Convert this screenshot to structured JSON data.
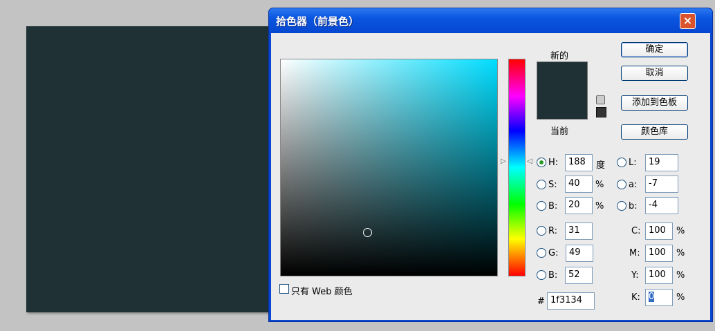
{
  "dialog": {
    "title": "拾色器（前景色）",
    "close_icon": "×"
  },
  "preview": {
    "new_label": "新的",
    "current_label": "当前",
    "new_color": "#1f3134",
    "current_color": "#1f3134"
  },
  "buttons": {
    "ok": "确定",
    "cancel": "取消",
    "add_swatch": "添加到色板",
    "libraries": "颜色库"
  },
  "hsb": {
    "h_label": "H:",
    "h": "188",
    "h_unit": "度",
    "s_label": "S:",
    "s": "40",
    "s_unit": "%",
    "b_label": "B:",
    "b": "20",
    "b_unit": "%"
  },
  "rgb": {
    "r_label": "R:",
    "r": "31",
    "g_label": "G:",
    "g": "49",
    "b_label": "B:",
    "b": "52"
  },
  "lab": {
    "l_label": "L:",
    "l": "19",
    "a_label": "a:",
    "a": "-7",
    "b_label": "b:",
    "b": "-4"
  },
  "cmyk": {
    "c_label": "C:",
    "c": "100",
    "m_label": "M:",
    "m": "100",
    "y_label": "Y:",
    "y": "100",
    "k_label": "K:",
    "k": "0",
    "unit": "%"
  },
  "hex": {
    "label": "#",
    "value": "1f3134"
  },
  "web_only": {
    "label": "只有 Web 颜色",
    "checked": false
  },
  "colors": {
    "field_hue": "#00ddff",
    "foreground": "#1f3134"
  }
}
